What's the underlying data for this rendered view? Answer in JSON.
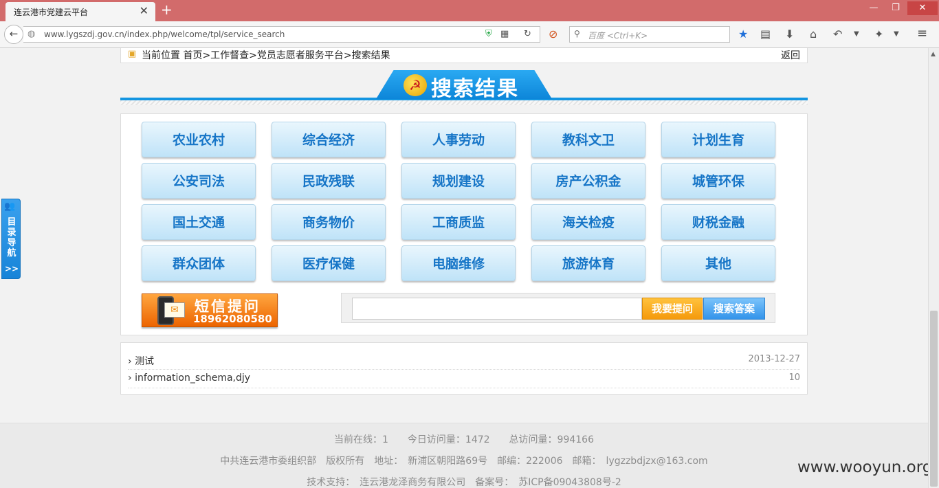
{
  "browser": {
    "tab_title": "连云港市党建云平台",
    "url": "www.lygszdj.gov.cn/index.php/welcome/tpl/service_search",
    "search_placeholder": "百度 <Ctrl+K>"
  },
  "breadcrumb": {
    "text": "当前位置 首页>工作督查>党员志愿者服务平台>搜索结果",
    "back": "返回"
  },
  "banner": {
    "title": "搜索结果"
  },
  "side_nav": {
    "label": "目录导航",
    "arrow": ">>"
  },
  "categories": [
    "农业农村",
    "综合经济",
    "人事劳动",
    "教科文卫",
    "计划生育",
    "公安司法",
    "民政残联",
    "规划建设",
    "房产公积金",
    "城管环保",
    "国土交通",
    "商务物价",
    "工商质监",
    "海关检疫",
    "财税金融",
    "群众团体",
    "医疗保健",
    "电脑维修",
    "旅游体育",
    "其他"
  ],
  "sms": {
    "title": "短信提问",
    "phone": "18962080580"
  },
  "ask": {
    "input_value": "",
    "ask_label": "我要提问",
    "search_label": "搜索答案"
  },
  "results": [
    {
      "title": "测试",
      "meta": "2013-12-27"
    },
    {
      "title": "information_schema,djy",
      "meta": "10"
    }
  ],
  "footer": {
    "line1": "当前在线：1　　今日访问量：1472　　总访问量：994166",
    "line2": "中共连云港市委组织部　版权所有　地址：　新浦区朝阳路69号　邮编：222006　邮箱：　lygzzbdjzx@163.com",
    "line3": "技术支持：　连云港龙泽商务有限公司　备案号：　苏ICP备09043808号-2"
  },
  "watermark": "www.wooyun.org",
  "colors": {
    "titlebar": "#d26b6b",
    "accent_blue": "#1495e1",
    "button_text": "#1675c7",
    "sms_orange": "#ec6400"
  }
}
